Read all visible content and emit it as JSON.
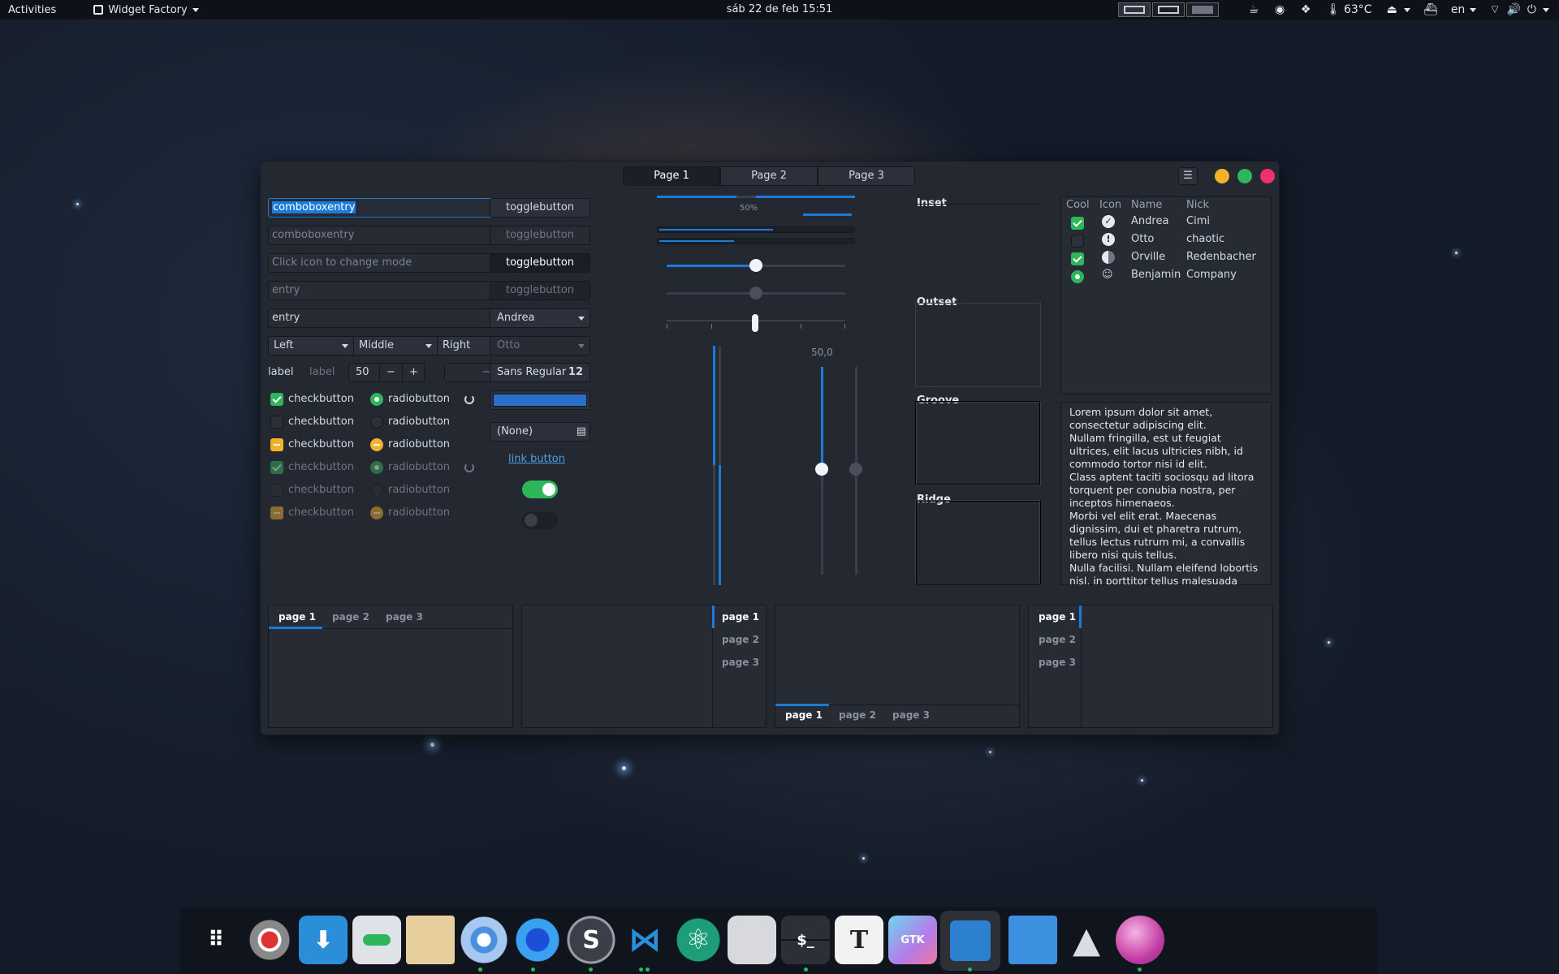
{
  "topbar": {
    "activities": "Activities",
    "app_name": "Widget Factory",
    "clock": "sáb 22 de feb  15:51",
    "temperature": "63°C",
    "language": "en"
  },
  "window": {
    "pages": [
      "Page 1",
      "Page 2",
      "Page 3"
    ],
    "controls": {
      "minimize_color": "#f3b22a",
      "maximize_color": "#2eb75a",
      "close_color": "#ef2f6e"
    }
  },
  "entries": {
    "combo1": "comboboxentry",
    "combo2": "comboboxentry",
    "icon_entry_placeholder": "Click icon to change mode",
    "entry_placeholder": "entry",
    "entry_value": "entry",
    "left": "Left",
    "middle": "Middle",
    "right": "Right",
    "label1": "label",
    "label2": "label",
    "spin_value": "50"
  },
  "checks": [
    "checkbutton",
    "checkbutton",
    "checkbutton",
    "checkbutton",
    "checkbutton",
    "checkbutton"
  ],
  "radios": [
    "radiobutton",
    "radiobutton",
    "radiobutton",
    "radiobutton",
    "radiobutton",
    "radiobutton"
  ],
  "buttons": {
    "toggle": [
      "togglebutton",
      "togglebutton",
      "togglebutton",
      "togglebutton"
    ],
    "combo_andrea": "Andrea",
    "combo_otto": "Otto",
    "font_name": "Sans Regular",
    "font_size": "12",
    "color": "#2a6fc9",
    "file": "(None)",
    "link": "link button",
    "switch_on": true,
    "switch_off": false
  },
  "progress": {
    "label": "50%",
    "value": 0.5
  },
  "scale": {
    "value_label": "50,0",
    "value": 0.5
  },
  "frames": [
    "Inset",
    "Outset",
    "Groove",
    "Ridge"
  ],
  "tree": {
    "headers": [
      "Cool",
      "Icon",
      "Name",
      "Nick"
    ],
    "rows": [
      {
        "name": "Andrea",
        "nick": "Cimi",
        "cool": "checked"
      },
      {
        "name": "Otto",
        "nick": "chaotic",
        "cool": "unchecked"
      },
      {
        "name": "Orville",
        "nick": "Redenbacher",
        "cool": "checked"
      },
      {
        "name": "Benjamin",
        "nick": "Company",
        "cool": "radio"
      }
    ]
  },
  "textview": [
    "Lorem ipsum dolor sit amet, consectetur adipiscing elit.",
    "Nullam fringilla, est ut feugiat ultrices, elit lacus ultricies nibh, id commodo tortor nisi id elit.",
    "Class aptent taciti sociosqu ad litora torquent per conubia nostra, per inceptos himenaeos.",
    "Morbi vel elit erat. Maecenas dignissim, dui et pharetra rutrum, tellus lectus rutrum mi, a convallis libero nisi quis tellus.",
    "Nulla facilisi. Nullam eleifend lobortis nisl, in porttitor tellus malesuada vitae."
  ],
  "notebooks": [
    "page 1",
    "page 2",
    "page 3"
  ],
  "dock": {
    "items": [
      "app-grid-icon",
      "settings-icon",
      "downloader-icon",
      "tweaks-icon",
      "files-icon",
      "chromium-icon",
      "firefox-icon",
      "sublime-icon",
      "vscode-icon",
      "atom-icon",
      "gnome-builder-icon",
      "terminal-icon",
      "typora-icon",
      "gtk-inspector-icon",
      "widget-factory-icon",
      "virtual-machines-icon",
      "inkscape-icon",
      "color-picker-icon"
    ],
    "text_glyphs": {
      "sublime": "S",
      "typora": "T",
      "gtk": "GTK",
      "terminal": "$_"
    }
  }
}
